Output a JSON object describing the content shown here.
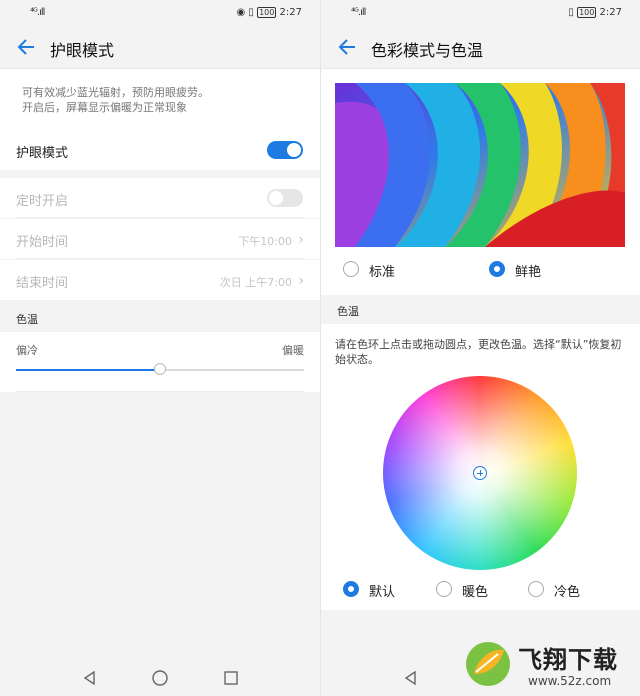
{
  "left": {
    "status": {
      "signal": "⁴ᴳ.ıll",
      "time": "2:27",
      "battery": "100"
    },
    "title": "护眼模式",
    "description": [
      "可有效减少蓝光辐射，预防用眼疲劳。",
      "开启后，屏幕显示偏暖为正常现象"
    ],
    "eye_mode": {
      "label": "护眼模式",
      "enabled": true
    },
    "schedule": {
      "label": "定时开启",
      "enabled": false
    },
    "start_time": {
      "label": "开始时间",
      "value": "下午10:00"
    },
    "end_time": {
      "label": "结束时间",
      "value": "次日 上午7:00"
    },
    "temp_section": "色温",
    "temp_slider": {
      "min_label": "偏冷",
      "max_label": "偏暖",
      "level": 0.5
    }
  },
  "right": {
    "status": {
      "signal": "⁴ᴳ.ıll",
      "time": "2:27",
      "battery": "100"
    },
    "title": "色彩模式与色温",
    "color_mode": {
      "options": [
        "标准",
        "鲜艳"
      ],
      "selected": "鲜艳"
    },
    "temp_section": "色温",
    "temp_help": "请在色环上点击或拖动圆点，更改色温。选择“默认”恢复初始状态。",
    "temp_presets": {
      "options": [
        "默认",
        "暖色",
        "冷色"
      ],
      "selected": "默认"
    }
  },
  "watermark": {
    "brand": "飞翔下载",
    "url": "www.52z.com"
  },
  "colors": {
    "accent": "#1e7be2",
    "page_bg": "#f3f3f3",
    "card_bg": "#ffffff"
  }
}
